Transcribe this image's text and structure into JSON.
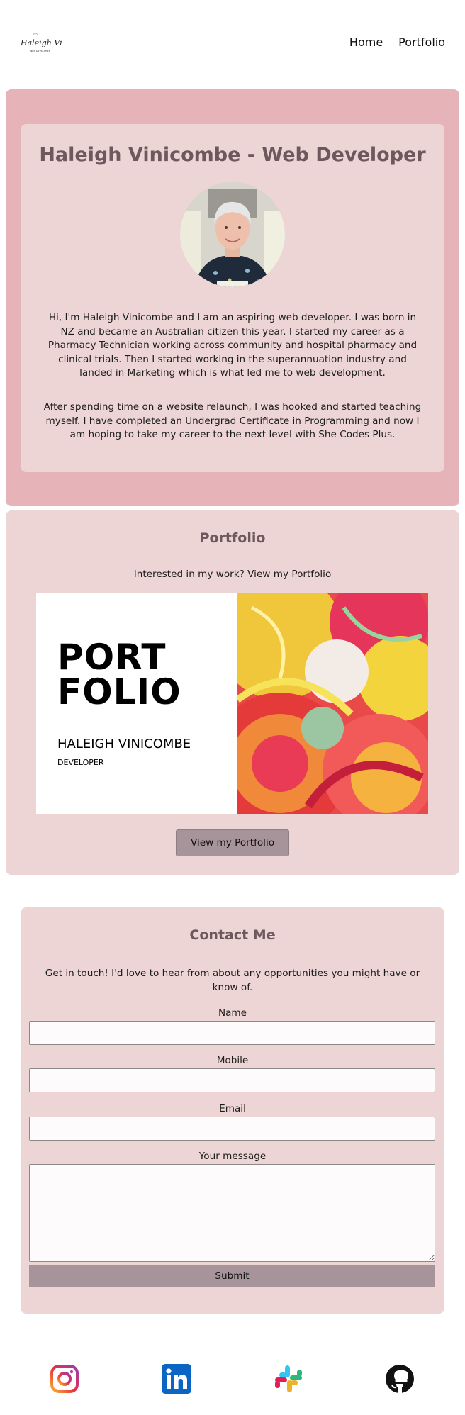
{
  "header": {
    "logo_script": "Haleigh Vinicombe",
    "logo_tagline": "WEB DEVELOPER",
    "nav": [
      {
        "label": "Home"
      },
      {
        "label": "Portfolio"
      }
    ]
  },
  "about": {
    "title": "Haleigh Vinicombe - Web Developer",
    "paragraph1": "Hi, I'm Haleigh Vinicombe and I am an aspiring web developer. I was born in NZ and became an Australian citizen this year. I started my career as a Pharmacy Technician working across community and hospital pharmacy and clinical trials. Then I started working in the superannuation industry and landed in Marketing which is what led me to web development.",
    "paragraph2": "After spending time on a website relaunch, I was hooked and started teaching myself. I have completed an Undergrad Certificate in Programming and now I am hoping to take my career to the next level with She Codes Plus."
  },
  "portfolio": {
    "title": "Portfolio",
    "subtitle": "Interested in my work? View my Portfolio",
    "image": {
      "line1": "PORT",
      "line2": "FOLIO",
      "name": "HALEIGH VINICOMBE",
      "role": "DEVELOPER"
    },
    "button_label": "View my Portfolio"
  },
  "contact": {
    "title": "Contact Me",
    "subtitle": "Get in touch! I'd love to hear from about any opportunities you might have or know of.",
    "fields": {
      "name_label": "Name",
      "mobile_label": "Mobile",
      "email_label": "Email",
      "message_label": "Your message"
    },
    "submit_label": "Submit"
  },
  "footer": {
    "icons": [
      "instagram-icon",
      "linkedin-icon",
      "slack-icon",
      "github-icon"
    ]
  },
  "colors": {
    "outer_pink": "#e6b3b8",
    "card_pink": "#ecd5d4",
    "heading": "#6e585d",
    "button": "#a7949a"
  }
}
